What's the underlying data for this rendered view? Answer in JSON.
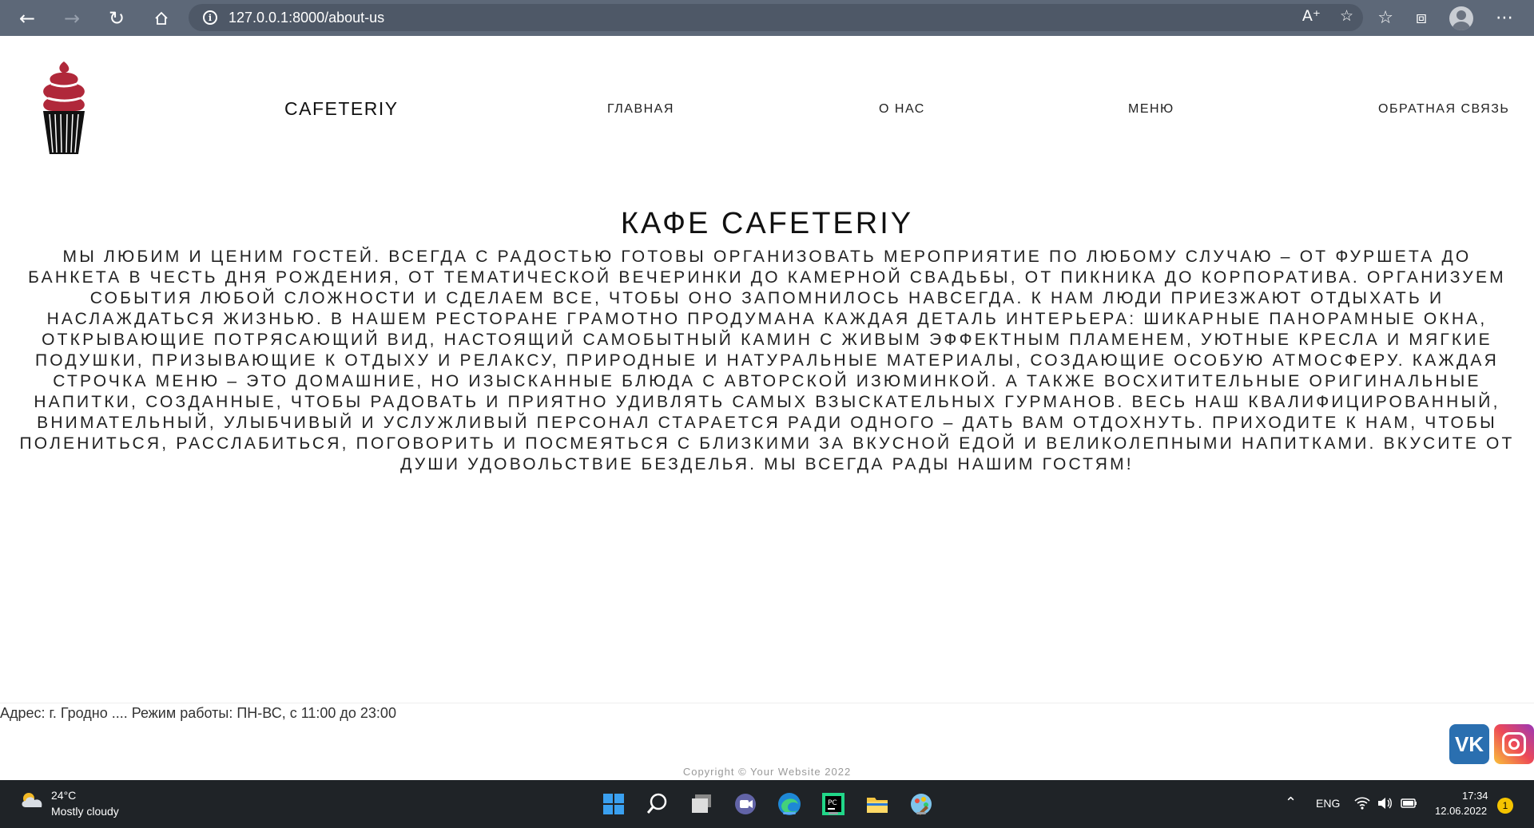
{
  "browser": {
    "url": "127.0.0.1:8000/about-us"
  },
  "header": {
    "brand": "CAFETERIY",
    "nav": [
      "ГЛАВНАЯ",
      "О НАС",
      "МЕНЮ",
      "ОБРАТНАЯ СВЯЗЬ"
    ]
  },
  "main": {
    "title": "КАФЕ CAFETERIY",
    "text": "Мы любим и ценим гостей. Всегда с радостью готовы организовать мероприятие по любому случаю – от фуршета до банкета в честь дня рождения, от тематической вечеринки до камерной свадьбы, от пикника до корпоратива. Организуем события любой сложности и сделаем все, чтобы оно запомнилось навсегда. К нам люди приезжают отдыхать и наслаждаться жизнью. В нашем ресторане грамотно продумана каждая деталь интерьера: шикарные панорамные окна, открывающие потрясающий вид, настоящий самобытный камин с живым эффектным пламенем, уютные кресла и мягкие подушки, призывающие к отдыху и релаксу, природные и натуральные материалы, создающие особую атмосферу. Каждая строчка меню – это домашние, но изысканные блюда с авторской изюминкой. А также восхитительные оригинальные напитки, созданные, чтобы радовать и приятно удивлять самых взыскательных гурманов. Весь наш квалифицированный, внимательный, улыбчивый и услужливый персонал старается ради одного – дать вам отдохнуть. Приходите к нам, чтобы полениться, расслабиться, поговорить и посмеяться с близкими за вкусной едой и великолепными напитками. Вкусите от души удовольствие безделья. Мы всегда рады нашим гостям!"
  },
  "footer": {
    "address": "Адрес: г. Гродно .... Режим работы: ПН-ВС, с 11:00 до 23:00",
    "vk_label": "VK",
    "copyright": "Copyright © Your Website 2022"
  },
  "taskbar": {
    "temperature": "24°C",
    "weather": "Mostly cloudy",
    "language": "ENG",
    "time": "17:34",
    "date": "12.06.2022",
    "notifications": "1"
  },
  "colors": {
    "chrome": "#5d6878",
    "taskbar": "#1f2327",
    "vk": "#2a6fb0"
  }
}
